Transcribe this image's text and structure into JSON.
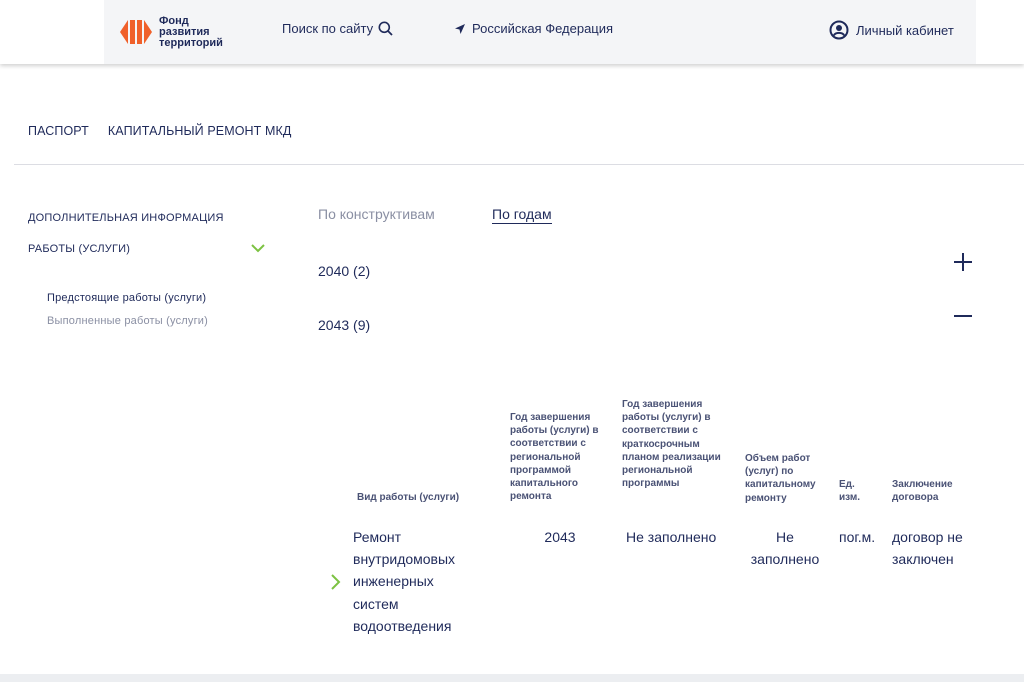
{
  "header": {
    "logo_lines": [
      "Фонд",
      "развития",
      "территорий"
    ],
    "search_label": "Поиск по сайту",
    "region_label": "Российская Федерация",
    "cabinet_label": "Личный кабинет"
  },
  "top_tabs": [
    "ПАСПОРТ",
    "КАПИТАЛЬНЫЙ РЕМОНТ МКД"
  ],
  "sidebar": {
    "additional_info": "ДОПОЛНИТЕЛЬНАЯ ИНФОРМАЦИЯ",
    "works": "РАБОТЫ (УСЛУГИ)",
    "items": [
      "Предстоящие работы (услуги)",
      "Выполненные работы (услуги)"
    ]
  },
  "view_tabs": [
    "По конструктивам",
    "По годам"
  ],
  "years": [
    {
      "label": "2040 (2)",
      "expanded": false
    },
    {
      "label": "2043 (9)",
      "expanded": true
    }
  ],
  "table": {
    "headers": {
      "work_type": "Вид работы (услуги)",
      "year_regional": "Год завершения работы (услуги) в соответствии с региональной программой капитального ремонта",
      "year_short": "Год завершения работы (услуги) в соответствии с краткосрочным планом реализации региональной программы",
      "volume": "Объем работ (услуг) по капитальному ремонту",
      "unit": "Ед. изм.",
      "contract": "Заключение договора"
    },
    "rows": [
      {
        "work_type": "Ремонт внутридомовых инженерных систем водоотведения",
        "year_regional": "2043",
        "year_short": "Не заполнено",
        "volume": "Не заполнено",
        "unit": "пог.м.",
        "contract": "договор не заключен"
      }
    ]
  },
  "colors": {
    "navy": "#1f2a5a",
    "logo_orange": "#f0602a",
    "accent_green": "#7cc242",
    "muted": "#8a8fa3"
  }
}
